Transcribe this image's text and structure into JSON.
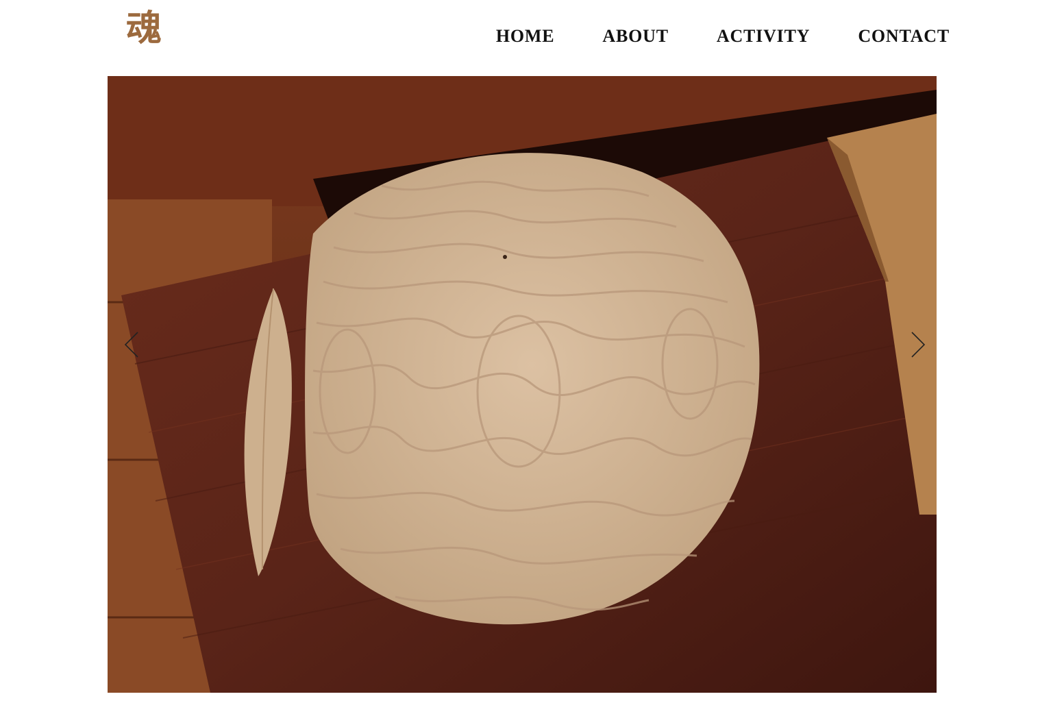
{
  "header": {
    "logo": {
      "text": "魂",
      "color": "#9c6a3e",
      "icon": "calligraphy-logo"
    },
    "nav": [
      {
        "label": "HOME"
      },
      {
        "label": "ABOUT"
      },
      {
        "label": "ACTIVITY"
      },
      {
        "label": "CONTACT"
      }
    ]
  },
  "slider": {
    "image_subject": "wooden-plate",
    "prev_icon": "chevron-left-icon",
    "next_icon": "chevron-right-icon",
    "colors": {
      "table": "#5a2418",
      "plate": "#d2b596",
      "plate_grain": "#b8977a",
      "arrow": "#222222"
    }
  }
}
